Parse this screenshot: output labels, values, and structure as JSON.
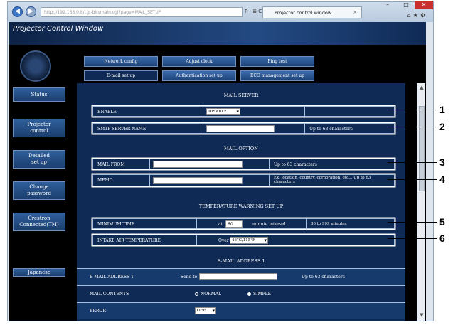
{
  "browser": {
    "address": "http://192.168.0.8/cgi-bin/main.cgi?page=MAIL_SETUP",
    "tab_title": "Projector control window",
    "tab_close": "×",
    "search_hint": "P - ≣ C"
  },
  "app": {
    "title": "Projector Control Window",
    "sidebar": [
      {
        "label": "Status"
      },
      {
        "label": "Projector\ncontrol"
      },
      {
        "label": "Detailed\nset up"
      },
      {
        "label": "Change\npassword"
      },
      {
        "label": "Crestron\nConnected(TM)"
      },
      {
        "label": "Japanese"
      }
    ],
    "tabs_row1": [
      "Network config",
      "Adjust clock",
      "Ping test"
    ],
    "tabs_row2": [
      "E-mail set up",
      "Authentication set up",
      "ECO management set up"
    ]
  },
  "mail_server": {
    "title": "MAIL SERVER",
    "enable_label": "ENABLE",
    "enable_value": "DISABLE",
    "smtp_label": "SMTP SERVER NAME",
    "smtp_value": "",
    "smtp_hint": "Up to 63 characters"
  },
  "mail_option": {
    "title": "MAIL OPTION",
    "from_label": "MAIL FROM",
    "from_value": "",
    "from_hint": "Up to 63 characters",
    "memo_label": "MEMO",
    "memo_value": "",
    "memo_hint": "Ex. location, country, corporation, etc... Up to 63 characters"
  },
  "temperature": {
    "title": "TEMPERATURE WARNING SET UP",
    "min_time_label": "MINIMUM TIME",
    "min_time_prefix": "at",
    "min_time_value": "60",
    "min_time_unit": "minute interval",
    "min_time_hint": "30 to 999 minutes",
    "intake_label": "INTAKE AIR TEMPERATURE",
    "intake_prefix": "Over",
    "intake_value": "46°C/115°F"
  },
  "email1": {
    "title": "E-MAIL ADDRESS 1",
    "address_label": "E-MAIL ADDRESS 1",
    "address_prefix": "Send to",
    "address_value": "",
    "address_hint": "Up to 63 characters",
    "contents_label": "MAIL CONTENTS",
    "contents_normal": "NORMAL",
    "contents_simple": "SIMPLE",
    "error_label": "ERROR",
    "error_value": "OFF"
  },
  "callouts": [
    "1",
    "2",
    "3",
    "4",
    "5",
    "6"
  ]
}
